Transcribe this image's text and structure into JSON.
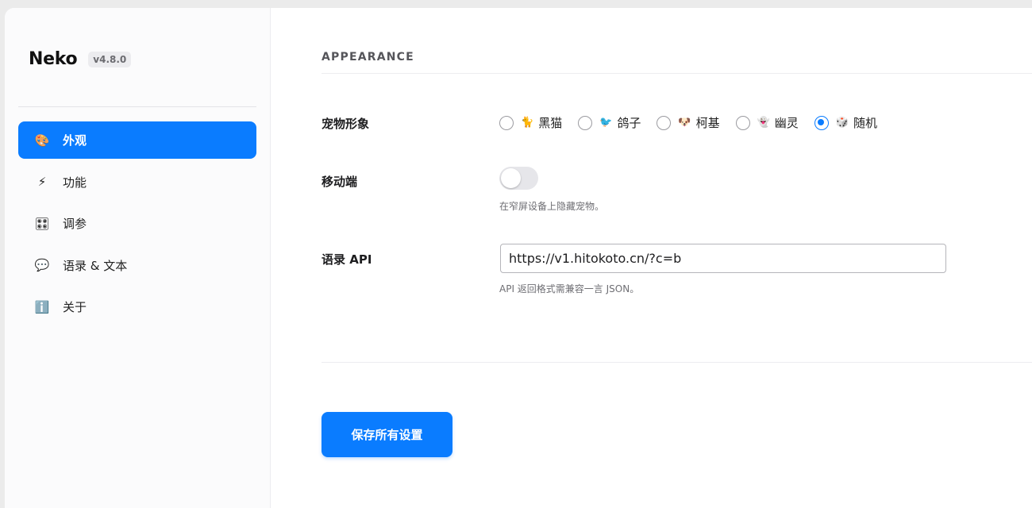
{
  "brand": {
    "name": "Neko",
    "version": "v4.8.0"
  },
  "sidebar": {
    "items": [
      {
        "label": "外观",
        "icon": "🎨",
        "active": true
      },
      {
        "label": "功能",
        "icon": "⚡"
      },
      {
        "label": "调参",
        "icon": "🎛"
      },
      {
        "label": "语录 & 文本",
        "icon": "💬"
      },
      {
        "label": "关于",
        "icon": "ℹ️"
      }
    ]
  },
  "main": {
    "section_title": "APPEARANCE",
    "pet": {
      "label": "宠物形象",
      "options": [
        {
          "label": "黑猫",
          "emoji": "🐈",
          "checked": false
        },
        {
          "label": "鸽子",
          "emoji": "🐦",
          "checked": false
        },
        {
          "label": "柯基",
          "emoji": "🐶",
          "checked": false
        },
        {
          "label": "幽灵",
          "emoji": "👻",
          "checked": false
        },
        {
          "label": "随机",
          "emoji": "🎲",
          "checked": true
        }
      ]
    },
    "mobile": {
      "label": "移动端",
      "enabled": false,
      "hint": "在窄屏设备上隐藏宠物。"
    },
    "api": {
      "label": "语录 API",
      "value": "https://v1.hitokoto.cn/?c=b",
      "hint": "API 返回格式需兼容一言 JSON。"
    },
    "save_label": "保存所有设置"
  },
  "colors": {
    "accent": "#0a7cff"
  }
}
